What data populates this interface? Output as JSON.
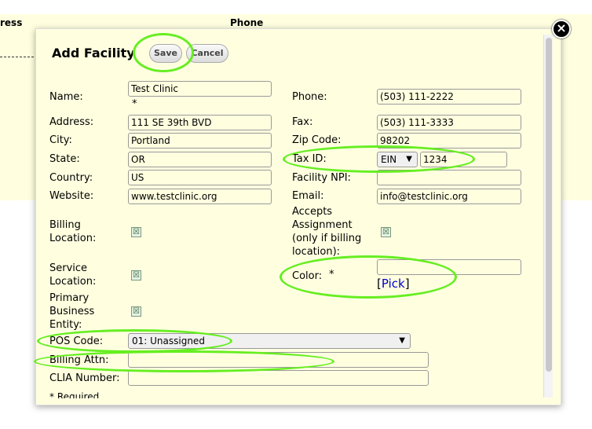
{
  "background": {
    "col1_header": "ress",
    "col2_header": "Phone"
  },
  "dialog": {
    "title": "Add Facility",
    "save_label": "Save",
    "cancel_label": "Cancel",
    "close_label": "×",
    "required_asterisk": "*",
    "footer_note": "* Required"
  },
  "form": {
    "name_label": "Name:",
    "name_value": "Test Clinic",
    "address_label": "Address:",
    "address_value": "111 SE 39th BVD",
    "city_label": "City:",
    "city_value": "Portland",
    "state_label": "State:",
    "state_value": "OR",
    "country_label": "Country:",
    "country_value": "US",
    "website_label": "Website:",
    "website_value": "www.testclinic.org",
    "billing_location_label_1": "Billing",
    "billing_location_label_2": "Location:",
    "service_location_label_1": "Service",
    "service_location_label_2": "Location:",
    "primary_business_label_1": "Primary",
    "primary_business_label_2": "Business",
    "primary_business_label_3": "Entity:",
    "pos_code_label": "POS Code:",
    "pos_code_value": "01: Unassigned",
    "billing_attn_label": "Billing Attn:",
    "billing_attn_value": "",
    "clia_label": "CLIA Number:",
    "clia_value": "",
    "phone_label": "Phone:",
    "phone_value": "(503) 111-2222",
    "fax_label": "Fax:",
    "fax_value": "(503) 111-3333",
    "zip_label": "Zip Code:",
    "zip_value": "98202",
    "tax_id_label": "Tax ID:",
    "tax_id_type": "EIN",
    "tax_id_value": "1234",
    "facility_npi_label": "Facility NPI:",
    "facility_npi_value": "",
    "email_label": "Email:",
    "email_value": "info@testclinic.org",
    "accepts_assignment_label_1": "Accepts",
    "accepts_assignment_label_2": "Assignment",
    "accepts_assignment_label_3": "(only if billing",
    "accepts_assignment_label_4": "location):",
    "color_label": "Color:",
    "color_value": "",
    "pick_open": "[",
    "pick_label": "Pick",
    "pick_close": "]",
    "checkbox_mark": "☒"
  },
  "colors": {
    "highlight_ring": "#66ee22",
    "panel_bg": "#ffffe0",
    "link": "#0000cc"
  }
}
